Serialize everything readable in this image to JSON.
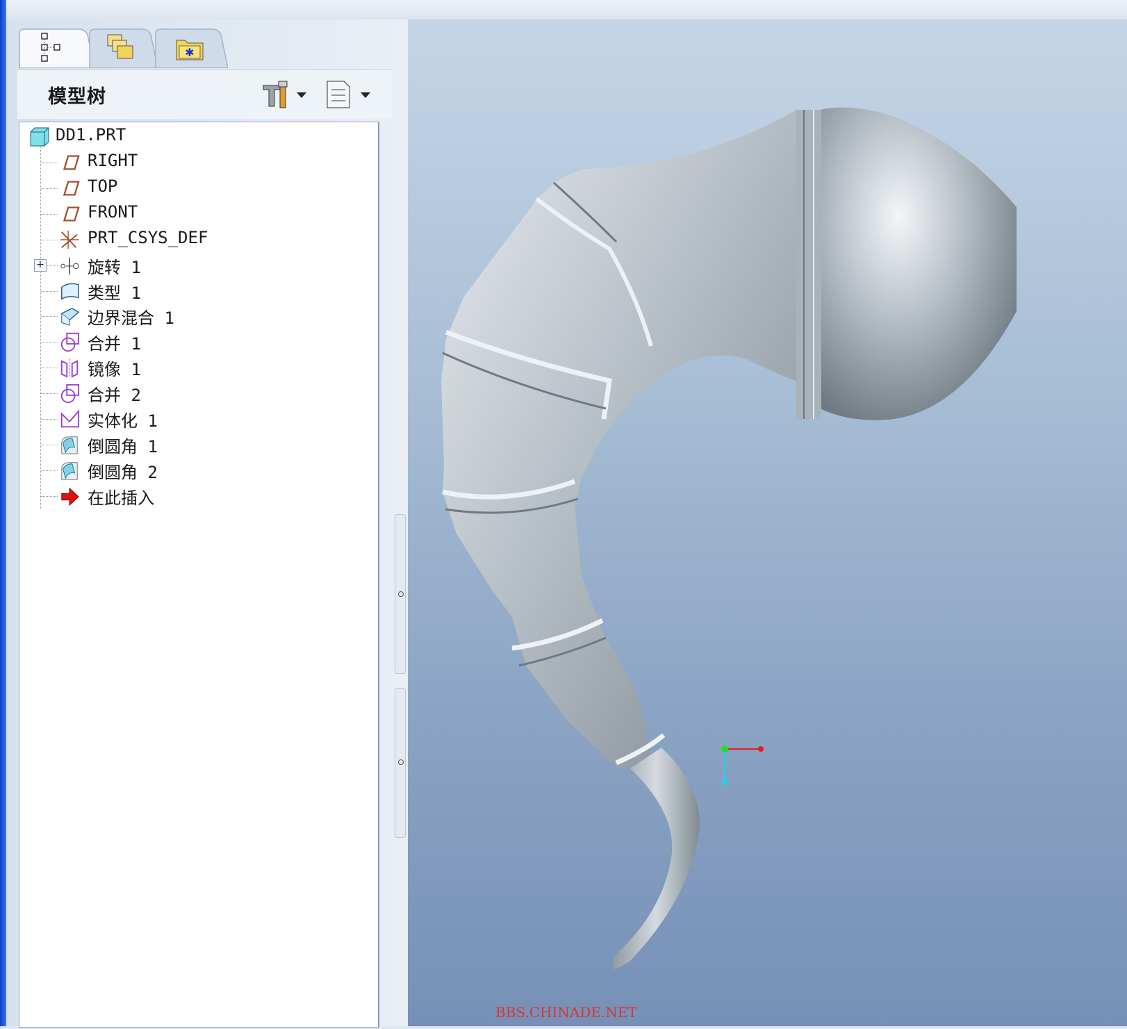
{
  "panel": {
    "tabs": [
      {
        "name": "model-tree-tab",
        "icon": "model-tree-icon",
        "active": true
      },
      {
        "name": "layers-tab",
        "icon": "layers-icon",
        "active": false
      },
      {
        "name": "favorites-tab",
        "icon": "favorites-folder-icon",
        "active": false
      }
    ],
    "header": {
      "title": "模型树",
      "settings_icon": "tools-settings-icon",
      "show_icon": "show-list-icon"
    }
  },
  "tree": {
    "root": {
      "label": "DD1.PRT",
      "icon": "part-icon"
    },
    "items": [
      {
        "label": "RIGHT",
        "icon": "datum-plane-icon"
      },
      {
        "label": "TOP",
        "icon": "datum-plane-icon"
      },
      {
        "label": "FRONT",
        "icon": "datum-plane-icon"
      },
      {
        "label": "PRT_CSYS_DEF",
        "icon": "coordinate-system-icon"
      },
      {
        "label": "旋转 1",
        "icon": "revolve-icon",
        "expandable": true
      },
      {
        "label": "类型 1",
        "icon": "style-surface-icon"
      },
      {
        "label": "边界混合 1",
        "icon": "boundary-blend-icon"
      },
      {
        "label": "合并 1",
        "icon": "merge-icon"
      },
      {
        "label": "镜像 1",
        "icon": "mirror-icon"
      },
      {
        "label": "合并 2",
        "icon": "merge-icon"
      },
      {
        "label": "实体化 1",
        "icon": "solidify-icon"
      },
      {
        "label": "倒圆角 1",
        "icon": "round-icon"
      },
      {
        "label": "倒圆角 2",
        "icon": "round-icon"
      },
      {
        "label": "在此插入",
        "icon": "insert-here-arrow-icon"
      }
    ]
  },
  "viewport": {
    "model": "3d-model",
    "triad": "coordinate-triad-icon"
  },
  "watermark": "BBS.CHINADE.NET",
  "colors": {
    "viewport_top": "#c5d5e6",
    "viewport_bottom": "#7690b7",
    "datum_plane": "#a0522d",
    "feature_purple": "#9b3fd0",
    "insert_arrow": "#e01010",
    "watermark": "#dd3333"
  }
}
